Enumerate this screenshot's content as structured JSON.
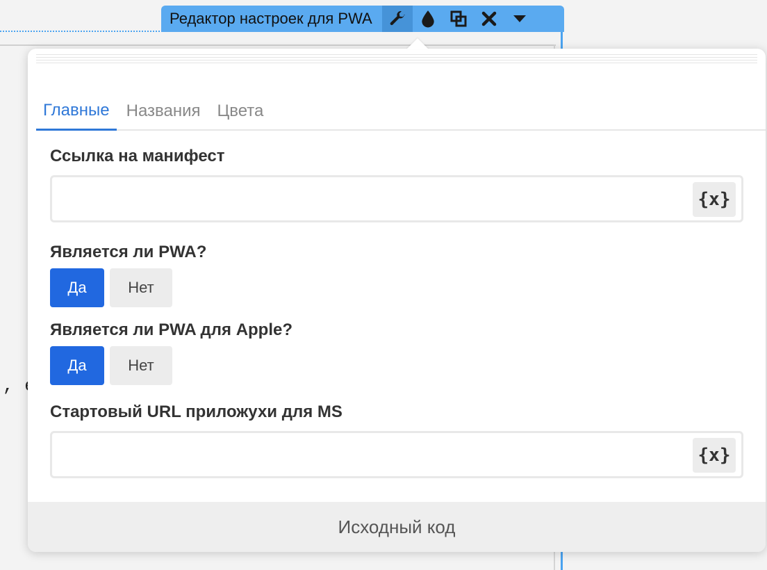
{
  "toolbar": {
    "title": "Редактор настроек для PWA",
    "icons": [
      "wrench-icon",
      "drop-icon",
      "duplicate-icon",
      "close-icon",
      "chevron-down-icon"
    ]
  },
  "background": {
    "code_fragment": ", е"
  },
  "tabs": [
    {
      "label": "Главные",
      "active": true
    },
    {
      "label": "Названия",
      "active": false
    },
    {
      "label": "Цвета",
      "active": false
    }
  ],
  "fields": {
    "manifest_link": {
      "label": "Ссылка на манифест",
      "value": "",
      "var_button": "{x}"
    },
    "is_pwa": {
      "label": "Является ли PWA?",
      "options": [
        "Да",
        "Нет"
      ],
      "selected": "Да"
    },
    "is_pwa_apple": {
      "label": "Является ли PWA для Apple?",
      "options": [
        "Да",
        "Нет"
      ],
      "selected": "Да"
    },
    "ms_start_url": {
      "label": "Стартовый URL приложухи для MS",
      "value": "",
      "var_button": "{x}"
    }
  },
  "footer": {
    "label": "Исходный код"
  },
  "colors": {
    "accent": "#2168e0",
    "toolbar": "#5aaaf0",
    "tab_active": "#2f78d8"
  }
}
